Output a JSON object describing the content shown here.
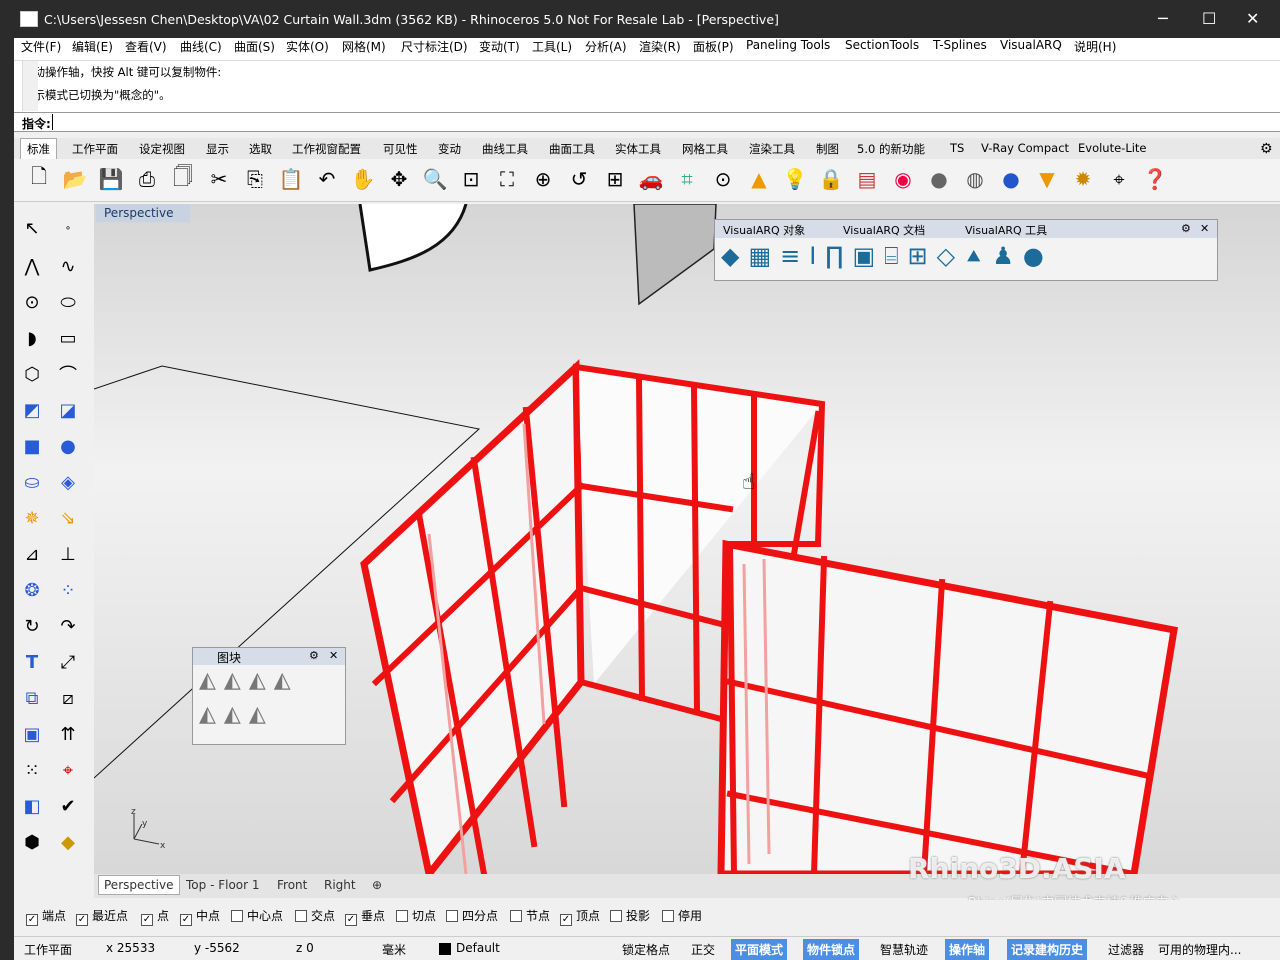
{
  "titlebar": {
    "title": "C:\\Users\\Jessesn Chen\\Desktop\\VA\\02 Curtain Wall.3dm (3562 KB) - Rhinoceros 5.0 Not For Resale Lab - [Perspective]",
    "min": "─",
    "max": "☐",
    "close": "✕"
  },
  "menu": [
    "文件(F)",
    "编辑(E)",
    "查看(V)",
    "曲线(C)",
    "曲面(S)",
    "实体(O)",
    "网格(M)",
    "尺寸标注(D)",
    "变动(T)",
    "工具(L)",
    "分析(A)",
    "渲染(R)",
    "面板(P)",
    "Paneling Tools",
    "SectionTools",
    "T-Splines",
    "VisualARQ",
    "说明(H)"
  ],
  "command": {
    "line1": "移动操作轴，快按 Alt 键可以复制物件:",
    "line2": "显示模式已切换为\"概念的\"。",
    "prompt": "指令:"
  },
  "tabs": [
    "标准",
    "工作平面",
    "设定视图",
    "显示",
    "选取",
    "工作视窗配置",
    "可见性",
    "变动",
    "曲线工具",
    "曲面工具",
    "实体工具",
    "网格工具",
    "渲染工具",
    "制图",
    "5.0 的新功能",
    "TS",
    "V-Ray Compact",
    "Evolute-Lite"
  ],
  "viewport": {
    "label": "Perspective"
  },
  "visualarq": {
    "tab1": "VisualARQ 对象",
    "tab2": "VisualARQ 文档",
    "tab3": "VisualARQ 工具"
  },
  "blocks": {
    "title": "图块"
  },
  "viewtabs": [
    "Perspective",
    "Top - Floor 1",
    "Front",
    "Right"
  ],
  "osnaps": [
    {
      "label": "端点",
      "checked": true
    },
    {
      "label": "最近点",
      "checked": true
    },
    {
      "label": "点",
      "checked": true
    },
    {
      "label": "中点",
      "checked": true
    },
    {
      "label": "中心点",
      "checked": false
    },
    {
      "label": "交点",
      "checked": false
    },
    {
      "label": "垂点",
      "checked": true
    },
    {
      "label": "切点",
      "checked": false
    },
    {
      "label": "四分点",
      "checked": false
    },
    {
      "label": "节点",
      "checked": false
    },
    {
      "label": "顶点",
      "checked": true
    },
    {
      "label": "投影",
      "checked": false
    },
    {
      "label": "停用",
      "checked": false
    }
  ],
  "status": {
    "cplane": "工作平面",
    "x": "x 25533",
    "y": "y -5562",
    "z": "z 0",
    "units": "毫米",
    "layer": "Default",
    "grid": "锁定格点",
    "ortho": "正交",
    "planar": "平面模式",
    "osnap": "物件锁点",
    "smart": "智慧轨迹",
    "gumball": "操作轴",
    "history": "记录建构历史",
    "filter": "过滤器",
    "memory": "可用的物理内..."
  },
  "watermark": {
    "main": "Rhino3D.ASIA",
    "sub": "Rhino(犀牛)中国技术支持&推广中心"
  },
  "colors": {
    "frame": "#ee1111",
    "titlebar": "#2b2b2b",
    "highlight": "#4c8fe2"
  }
}
